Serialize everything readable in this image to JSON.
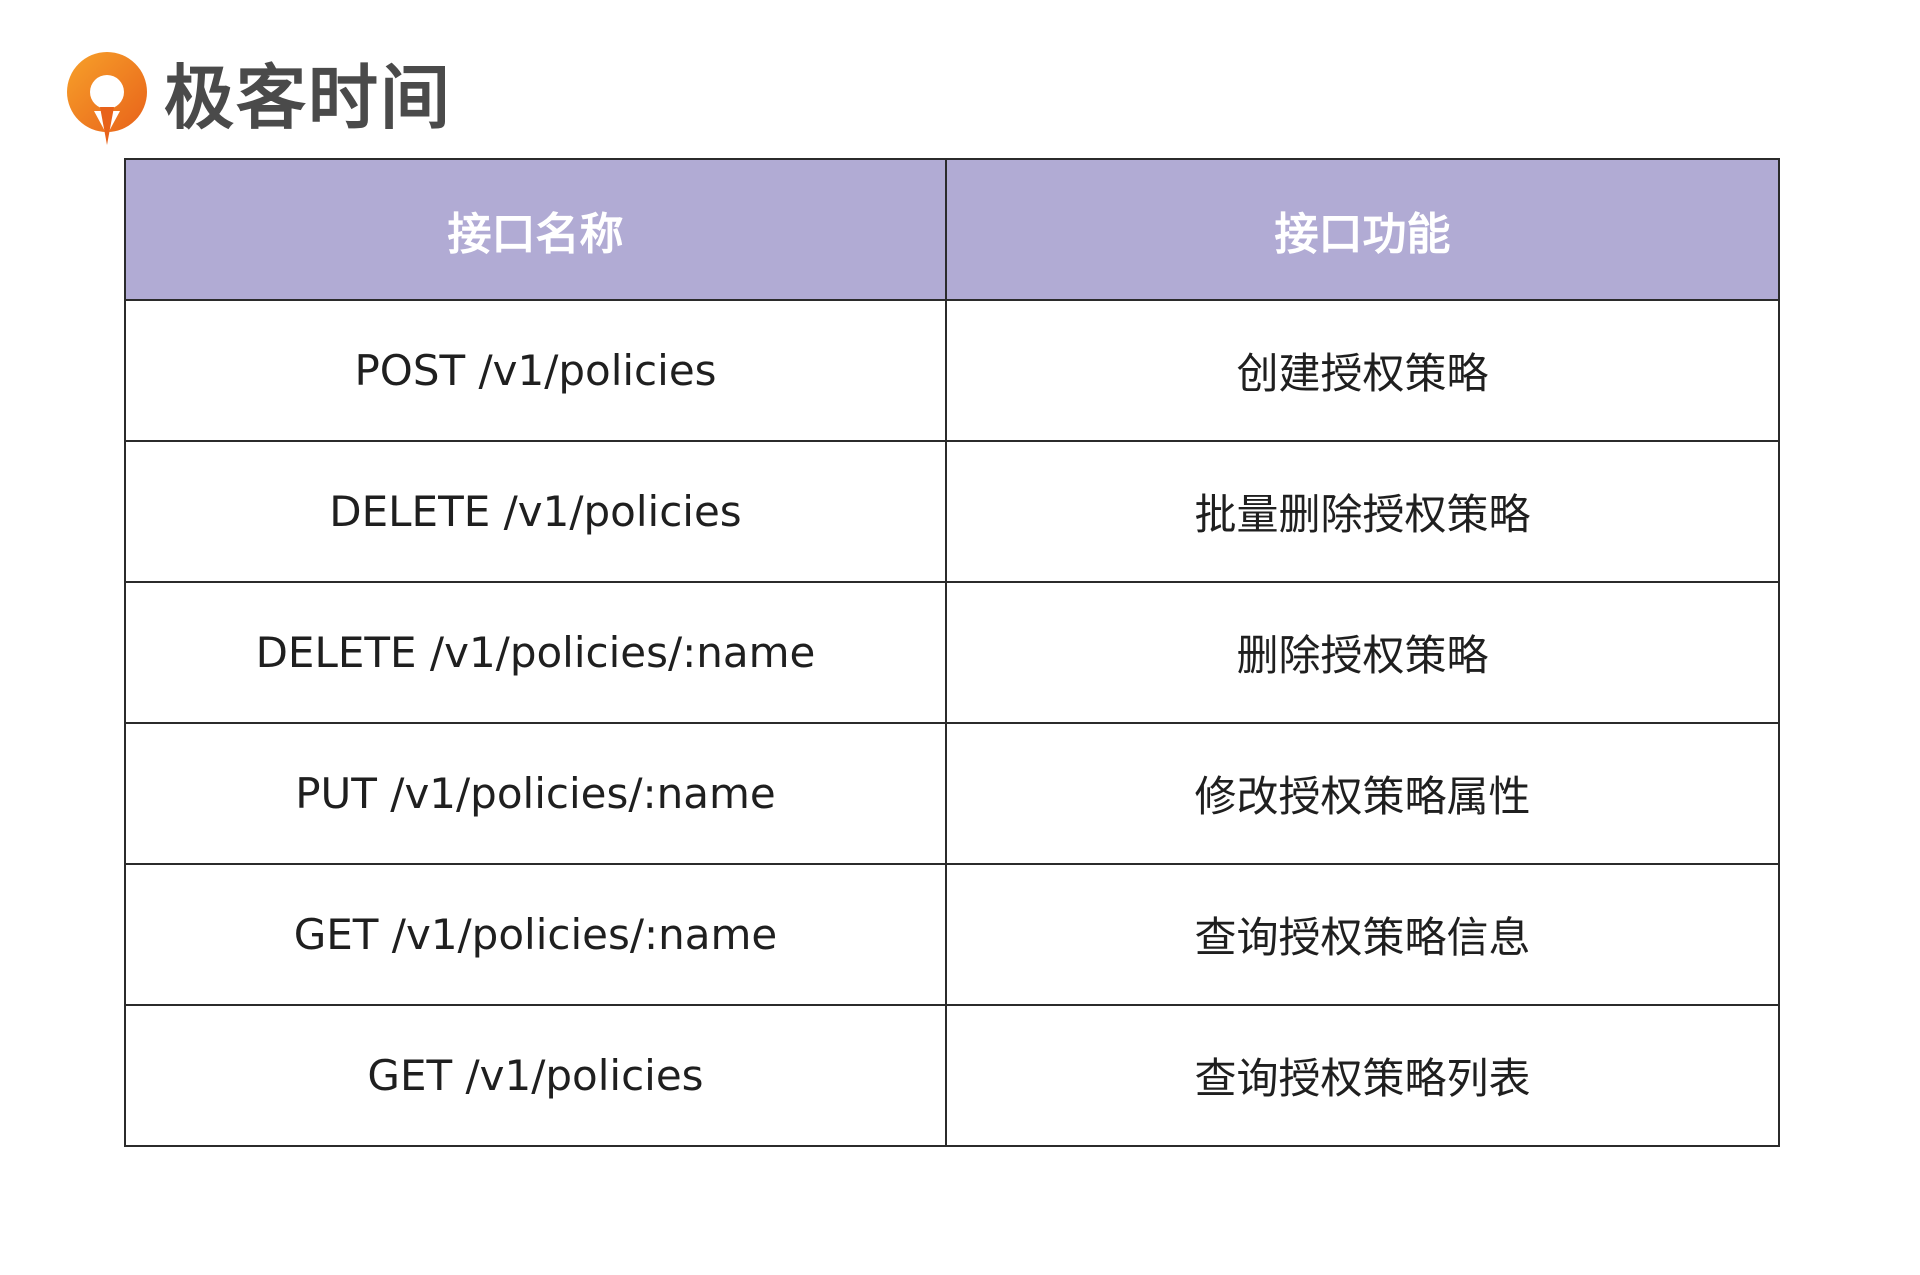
{
  "brand": {
    "name": "极客时间",
    "logo_icon": "geektime-logo-icon",
    "accent_color": "#f08a1c"
  },
  "table": {
    "header_color": "#b1abd4",
    "headers": [
      "接口名称",
      "接口功能"
    ],
    "rows": [
      [
        "POST /v1/policies",
        "创建授权策略"
      ],
      [
        "DELETE /v1/policies",
        "批量删除授权策略"
      ],
      [
        "DELETE /v1/policies/:name",
        "删除授权策略"
      ],
      [
        "PUT /v1/policies/:name",
        "修改授权策略属性"
      ],
      [
        "GET /v1/policies/:name",
        "查询授权策略信息"
      ],
      [
        "GET /v1/policies",
        "查询授权策略列表"
      ]
    ]
  }
}
